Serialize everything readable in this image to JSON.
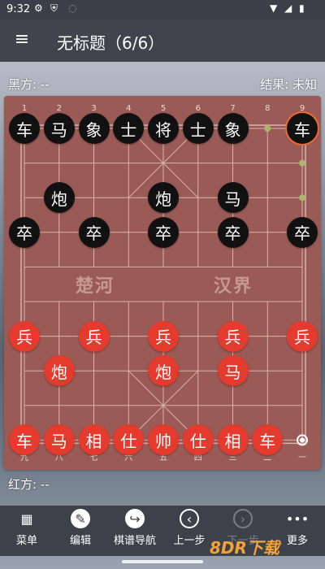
{
  "status": {
    "time": "9:32"
  },
  "appbar": {
    "title": "无标题（6/6）"
  },
  "players": {
    "black": "黑方: --",
    "red": "红方: --",
    "result": "结果: 未知"
  },
  "board": {
    "top_numbers": [
      "1",
      "2",
      "3",
      "4",
      "5",
      "6",
      "7",
      "8",
      "9"
    ],
    "bottom_numbers": [
      "九",
      "八",
      "七",
      "六",
      "五",
      "四",
      "三",
      "二",
      "一"
    ],
    "river_left": "楚河",
    "river_right": "汉界",
    "pieces": [
      {
        "t": "车",
        "c": "black",
        "col": 0,
        "row": 0
      },
      {
        "t": "马",
        "c": "black",
        "col": 1,
        "row": 0
      },
      {
        "t": "象",
        "c": "black",
        "col": 2,
        "row": 0
      },
      {
        "t": "士",
        "c": "black",
        "col": 3,
        "row": 0
      },
      {
        "t": "将",
        "c": "black",
        "col": 4,
        "row": 0
      },
      {
        "t": "士",
        "c": "black",
        "col": 5,
        "row": 0
      },
      {
        "t": "象",
        "c": "black",
        "col": 6,
        "row": 0
      },
      {
        "t": "车",
        "c": "black",
        "col": 8,
        "row": 0,
        "selected": true
      },
      {
        "t": "炮",
        "c": "black",
        "col": 1,
        "row": 2
      },
      {
        "t": "炮",
        "c": "black",
        "col": 4,
        "row": 2
      },
      {
        "t": "马",
        "c": "black",
        "col": 6,
        "row": 2
      },
      {
        "t": "卒",
        "c": "black",
        "col": 0,
        "row": 3
      },
      {
        "t": "卒",
        "c": "black",
        "col": 2,
        "row": 3
      },
      {
        "t": "卒",
        "c": "black",
        "col": 4,
        "row": 3
      },
      {
        "t": "卒",
        "c": "black",
        "col": 6,
        "row": 3
      },
      {
        "t": "卒",
        "c": "black",
        "col": 8,
        "row": 3
      },
      {
        "t": "兵",
        "c": "red",
        "col": 0,
        "row": 6
      },
      {
        "t": "兵",
        "c": "red",
        "col": 2,
        "row": 6
      },
      {
        "t": "兵",
        "c": "red",
        "col": 4,
        "row": 6
      },
      {
        "t": "兵",
        "c": "red",
        "col": 6,
        "row": 6
      },
      {
        "t": "兵",
        "c": "red",
        "col": 8,
        "row": 6
      },
      {
        "t": "炮",
        "c": "red",
        "col": 1,
        "row": 7
      },
      {
        "t": "炮",
        "c": "red",
        "col": 4,
        "row": 7
      },
      {
        "t": "马",
        "c": "red",
        "col": 6,
        "row": 7
      },
      {
        "t": "车",
        "c": "red",
        "col": 0,
        "row": 9
      },
      {
        "t": "马",
        "c": "red",
        "col": 1,
        "row": 9
      },
      {
        "t": "相",
        "c": "red",
        "col": 2,
        "row": 9
      },
      {
        "t": "仕",
        "c": "red",
        "col": 3,
        "row": 9
      },
      {
        "t": "帅",
        "c": "red",
        "col": 4,
        "row": 9
      },
      {
        "t": "仕",
        "c": "red",
        "col": 5,
        "row": 9
      },
      {
        "t": "相",
        "c": "red",
        "col": 6,
        "row": 9
      },
      {
        "t": "车",
        "c": "red",
        "col": 7,
        "row": 9
      }
    ]
  },
  "nav": [
    {
      "label": "菜单",
      "icon": "menu-grid-icon",
      "disabled": false
    },
    {
      "label": "编辑",
      "icon": "edit-icon",
      "disabled": false
    },
    {
      "label": "棋谱导航",
      "icon": "share-arrow-icon",
      "disabled": false
    },
    {
      "label": "上一步",
      "icon": "prev-icon",
      "disabled": false
    },
    {
      "label": "下一步",
      "icon": "next-icon",
      "disabled": true
    },
    {
      "label": "更多",
      "icon": "more-icon",
      "disabled": false
    }
  ],
  "watermark": "8DR下载",
  "colors": {
    "board": "#9a5b56",
    "red_piece": "#e43b2e",
    "black_piece": "#111111",
    "selected_ring": "#f06a2a"
  }
}
